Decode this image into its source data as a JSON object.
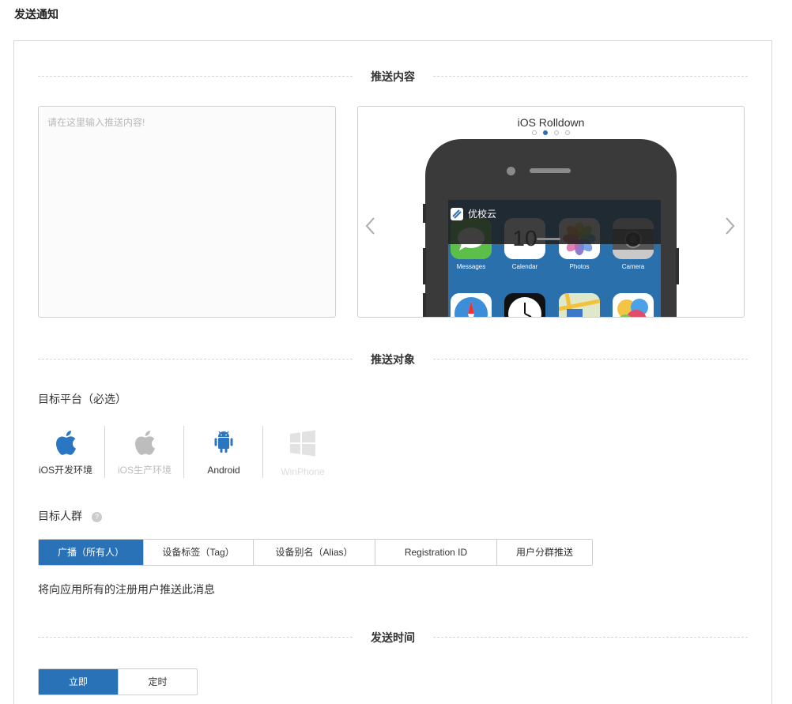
{
  "page_title": "发送通知",
  "sections": {
    "content": "推送内容",
    "target": "推送对象",
    "time": "发送时间"
  },
  "content": {
    "placeholder": "请在这里输入推送内容!"
  },
  "preview": {
    "title": "iOS Rolldown",
    "notification_app": "优校云",
    "apps_row1": [
      "Messages",
      "Calendar",
      "Photos",
      "Camera"
    ],
    "calendar_day": "10",
    "carousel_total": 4,
    "carousel_active": 2
  },
  "target": {
    "platform_label": "目标平台（必选）",
    "platforms": [
      {
        "label": "iOS开发环境",
        "icon": "apple-icon",
        "state": "enabled"
      },
      {
        "label": "iOS生产环境",
        "icon": "apple-icon",
        "state": "disabled"
      },
      {
        "label": "Android",
        "icon": "android-icon",
        "state": "enabled"
      },
      {
        "label": "WinPhone",
        "icon": "windows-icon",
        "state": "unavailable"
      }
    ],
    "audience_label": "目标人群",
    "help_symbol": "?",
    "audience_options": [
      "广播（所有人）",
      "设备标签（Tag）",
      "设备别名（Alias）",
      "Registration ID",
      "用户分群推送"
    ],
    "audience_selected": "广播（所有人）",
    "audience_desc": "将向应用所有的注册用户推送此消息"
  },
  "time": {
    "options": [
      "立即",
      "定时"
    ],
    "selected": "立即"
  },
  "colors": {
    "accent": "#2a72b8",
    "apple_blue": "#2b76c2",
    "disabled": "#bdbdbd",
    "unavailable": "#e2e2e2"
  }
}
